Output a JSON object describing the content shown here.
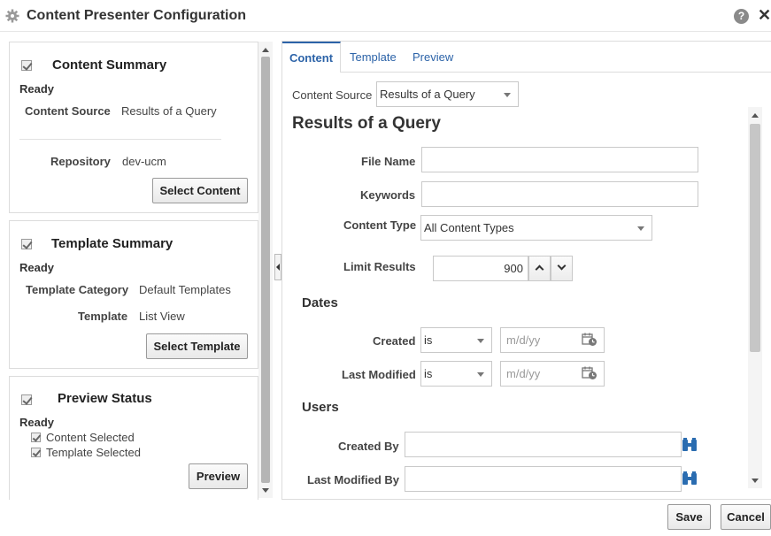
{
  "dialog": {
    "title": "Content Presenter Configuration",
    "help_glyph": "?",
    "close_glyph": "✕"
  },
  "content_summary": {
    "title": "Content Summary",
    "status": "Ready",
    "content_source_label": "Content Source",
    "content_source_value": "Results of a Query",
    "repository_label": "Repository",
    "repository_value": "dev-ucm",
    "button": "Select Content"
  },
  "template_summary": {
    "title": "Template Summary",
    "status": "Ready",
    "category_label": "Template Category",
    "category_value": "Default Templates",
    "template_label": "Template",
    "template_value": "List View",
    "button": "Select Template"
  },
  "preview_status": {
    "title": "Preview Status",
    "status": "Ready",
    "items": [
      "Content Selected",
      "Template Selected"
    ],
    "button": "Preview"
  },
  "tabs": [
    {
      "label": "Content",
      "active": true
    },
    {
      "label": "Template",
      "active": false
    },
    {
      "label": "Preview",
      "active": false
    }
  ],
  "form": {
    "content_source_label": "Content Source",
    "content_source_value": "Results of a Query",
    "heading": "Results of a Query",
    "file_name_label": "File Name",
    "file_name_value": "",
    "keywords_label": "Keywords",
    "keywords_value": "",
    "content_type_label": "Content Type",
    "content_type_value": "All Content Types",
    "limit_results_label": "Limit Results",
    "limit_results_value": "900",
    "dates_heading": "Dates",
    "created_label": "Created",
    "created_operator": "is",
    "created_placeholder": "m/d/yy",
    "last_modified_label": "Last Modified",
    "last_modified_operator": "is",
    "last_modified_placeholder": "m/d/yy",
    "users_heading": "Users",
    "created_by_label": "Created By",
    "created_by_value": "",
    "last_modified_by_label": "Last Modified By",
    "last_modified_by_value": ""
  },
  "footer": {
    "save": "Save",
    "cancel": "Cancel"
  },
  "colors": {
    "accent": "#2c63a8",
    "icon_blue": "#2a6cb0"
  }
}
